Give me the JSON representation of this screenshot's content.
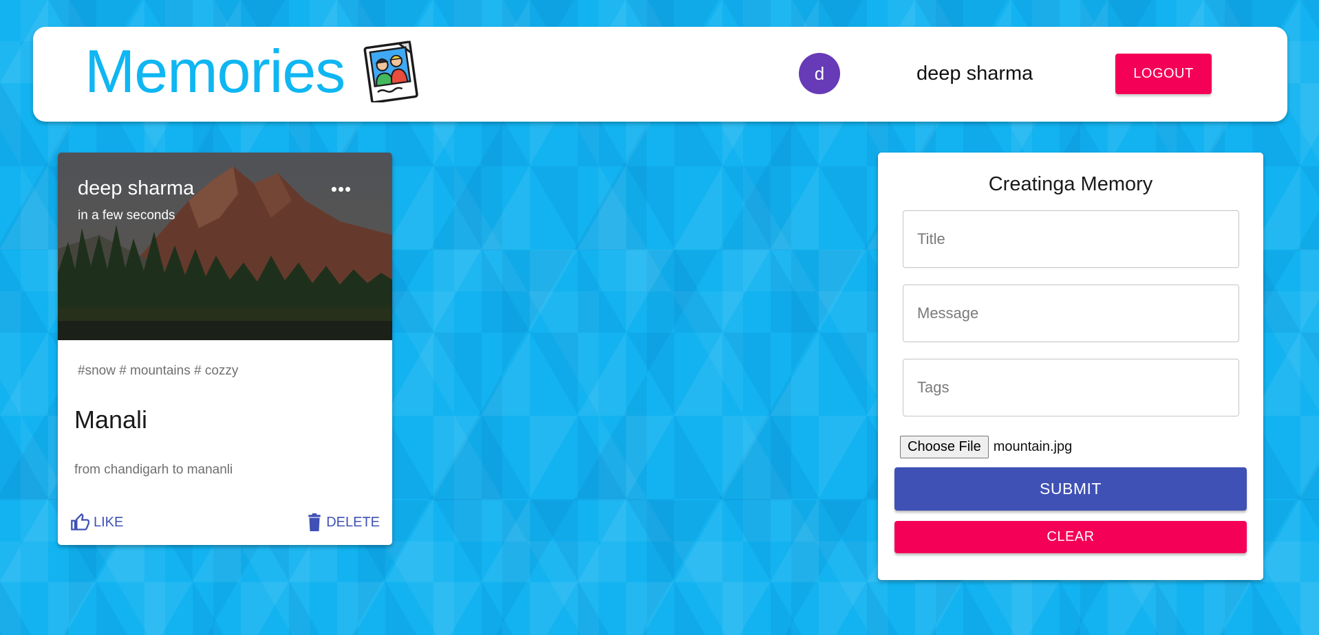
{
  "header": {
    "brand_title": "Memories",
    "brand_icon": "photo-friends-icon",
    "avatar_initial": "d",
    "user_name": "deep sharma",
    "logout_label": "LOGOUT"
  },
  "post": {
    "author": "deep sharma",
    "time": "in a few seconds",
    "more_label": "•••",
    "tags": "#snow # mountains # cozzy",
    "title": "Manali",
    "message": "from chandigarh to mananli",
    "like_label": "LIKE",
    "delete_label": "DELETE",
    "image_subject": "mountain landscape"
  },
  "form": {
    "title": "Creatinga Memory",
    "title_placeholder": "Title",
    "message_placeholder": "Message",
    "tags_placeholder": "Tags",
    "choose_file_label": "Choose File",
    "file_name": "mountain.jpg",
    "submit_label": "SUBMIT",
    "clear_label": "CLEAR"
  },
  "colors": {
    "brand": "#0fb6f2",
    "primary": "#3f51b5",
    "secondary": "#f50057",
    "avatar": "#673ab7",
    "background": "#12b3f0"
  }
}
